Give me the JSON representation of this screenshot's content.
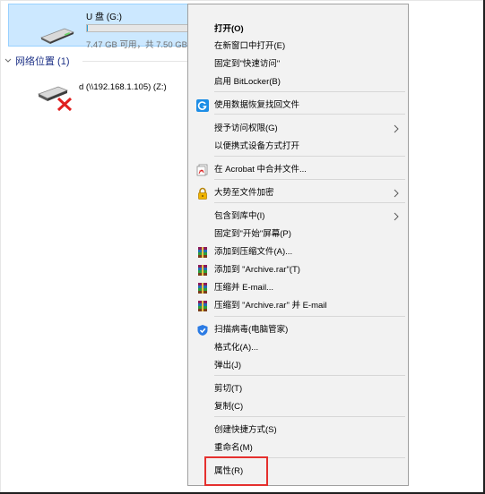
{
  "explorer": {
    "drive": {
      "name": "U 盘 (G:)",
      "size_text": "7.47 GB 可用，共 7.50 GB",
      "used_fraction": 0.004
    },
    "network_section": {
      "title": "网络位置 (1)"
    },
    "network_drive": {
      "name": "d (\\\\192.168.1.105) (Z:)"
    }
  },
  "context_menu": {
    "items": [
      {
        "id": "open",
        "label": "打开(O)",
        "bold": true
      },
      {
        "id": "open-new-window",
        "label": "在新窗口中打开(E)"
      },
      {
        "id": "pin-quick-access",
        "label": "固定到\"快速访问\""
      },
      {
        "id": "enable-bitlocker",
        "label": "启用 BitLocker(B)"
      },
      {
        "id": "recover-files",
        "label": "使用数据恢复找回文件",
        "icon": "recovery-g-icon"
      },
      {
        "id": "give-access",
        "label": "授予访问权限(G)",
        "submenu": true
      },
      {
        "id": "open-portable",
        "label": "以便携式设备方式打开"
      },
      {
        "id": "acrobat-combine",
        "label": "在 Acrobat 中合并文件...",
        "icon": "acrobat-icon"
      },
      {
        "id": "dashi-encrypt",
        "label": "大势至文件加密",
        "icon": "padlock-icon",
        "submenu": true
      },
      {
        "id": "include-library",
        "label": "包含到库中(I)",
        "submenu": true
      },
      {
        "id": "pin-start",
        "label": "固定到\"开始\"屏幕(P)"
      },
      {
        "id": "add-archive",
        "label": "添加到压缩文件(A)...",
        "icon": "winrar-icon"
      },
      {
        "id": "add-archive-rar",
        "label": "添加到 \"Archive.rar\"(T)",
        "icon": "winrar-icon"
      },
      {
        "id": "compress-email",
        "label": "压缩并 E-mail...",
        "icon": "winrar-icon"
      },
      {
        "id": "compress-rar-email",
        "label": "压缩到 \"Archive.rar\" 并 E-mail",
        "icon": "winrar-icon"
      },
      {
        "id": "scan-virus",
        "label": "扫描病毒(电脑管家)",
        "icon": "tencent-shield-icon"
      },
      {
        "id": "format",
        "label": "格式化(A)..."
      },
      {
        "id": "eject",
        "label": "弹出(J)"
      },
      {
        "id": "cut",
        "label": "剪切(T)"
      },
      {
        "id": "copy",
        "label": "复制(C)"
      },
      {
        "id": "create-shortcut",
        "label": "创建快捷方式(S)"
      },
      {
        "id": "rename",
        "label": "重命名(M)"
      },
      {
        "id": "properties",
        "label": "属性(R)"
      }
    ]
  },
  "colors": {
    "selection": "#cce8ff",
    "menu_bg": "#f2f2f2",
    "highlight_box": "#e5302e",
    "section_title": "#1e3287"
  }
}
